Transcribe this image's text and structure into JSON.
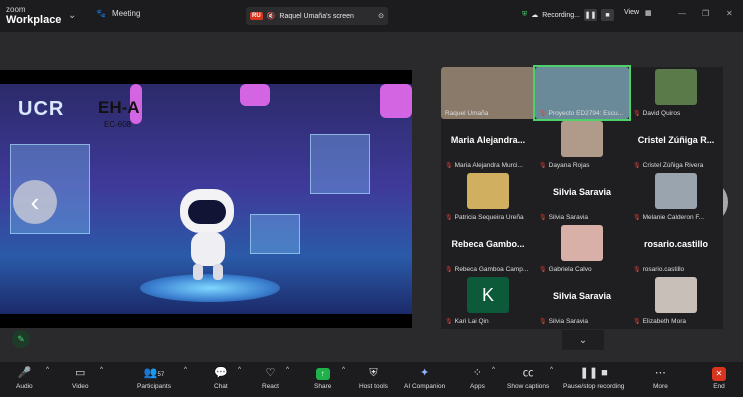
{
  "app": {
    "brand_top": "zoom",
    "brand_bottom": "Workplace",
    "meeting_tab": "Meeting"
  },
  "share_bar": {
    "initials": "RU",
    "label": "Raquel Umaña's screen"
  },
  "recording": {
    "label": "Recording..."
  },
  "view": {
    "label": "View"
  },
  "slide": {
    "logo": "UCR",
    "room": "EH-A",
    "code": "EC-608"
  },
  "gallery": {
    "tiles": [
      {
        "name": "Raquel Umaña",
        "big": "",
        "muted": false,
        "video": true
      },
      {
        "name": "Proyecto ED2794: Escu...",
        "big": "",
        "muted": true,
        "video": true,
        "highlight": true
      },
      {
        "name": "David Quiros",
        "big": "",
        "muted": true,
        "video": true
      },
      {
        "name": "Maria Alejandra Murci...",
        "big": "Maria Alejandra...",
        "muted": true,
        "video": false
      },
      {
        "name": "Dayana Rojas",
        "big": "",
        "muted": true,
        "video": true
      },
      {
        "name": "Cristel Zúñiga Rivera",
        "big": "Cristel Zúñiga R...",
        "muted": true,
        "video": false
      },
      {
        "name": "Patricia Sequeira Ureña",
        "big": "",
        "muted": true,
        "video": true
      },
      {
        "name": "Silvia Saravia",
        "big": "Silvia Saravia",
        "muted": true,
        "video": false
      },
      {
        "name": "Melanie Calderon F...",
        "big": "",
        "muted": true,
        "video": true
      },
      {
        "name": "Rebeca Gamboa Camp...",
        "big": "Rebeca Gambo...",
        "muted": true,
        "video": false
      },
      {
        "name": "Gabriela Calvo",
        "big": "",
        "muted": true,
        "video": true
      },
      {
        "name": "rosario.castillo",
        "big": "rosario.castillo",
        "muted": true,
        "video": false
      },
      {
        "name": "Kari Lai Qin",
        "big": "",
        "muted": true,
        "video": false,
        "avatar": "K"
      },
      {
        "name": "Silvia Saravia",
        "big": "Silvia Saravia",
        "muted": true,
        "video": false
      },
      {
        "name": "Elizabeth Mora",
        "big": "",
        "muted": true,
        "video": true
      }
    ]
  },
  "toolbar": {
    "audio": "Audio",
    "video": "Video",
    "participants": "Participants",
    "participants_count": "57",
    "chat": "Chat",
    "react": "React",
    "share": "Share",
    "host_tools": "Host tools",
    "ai": "AI Companion",
    "apps": "Apps",
    "captions": "Show captions",
    "recording": "Pause/stop recording",
    "more": "More",
    "end": "End"
  },
  "colors": {
    "accent_green": "#4cd16b",
    "end_red": "#d9341e",
    "share_green": "#20b24a"
  }
}
